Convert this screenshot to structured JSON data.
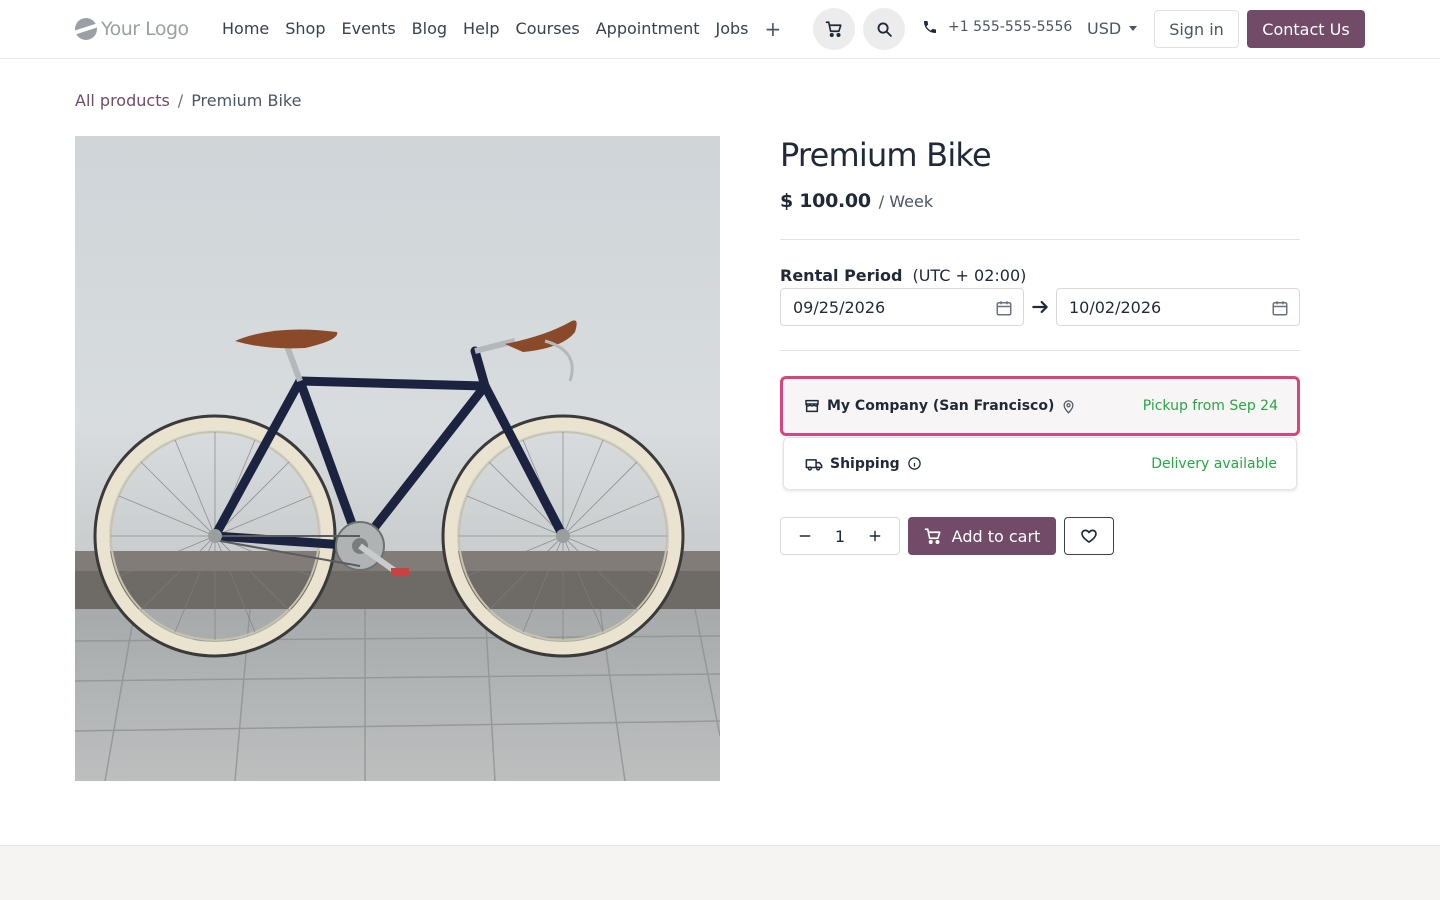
{
  "header": {
    "logo_text": "Your Logo",
    "nav": [
      "Home",
      "Shop",
      "Events",
      "Blog",
      "Help",
      "Courses",
      "Appointment",
      "Jobs"
    ],
    "nav_more": "+",
    "phone": "+1 555-555-5556",
    "currency": "USD",
    "sign_in": "Sign in",
    "contact": "Contact Us"
  },
  "breadcrumb": {
    "parent": "All products",
    "separator": "/",
    "current": "Premium Bike"
  },
  "product": {
    "title": "Premium Bike",
    "price": "$ 100.00",
    "period": "/ Week",
    "rental": {
      "label": "Rental Period",
      "timezone": "(UTC + 02:00)",
      "start": "09/25/2026",
      "end": "10/02/2026"
    },
    "pickup": {
      "name": "My Company (San Francisco)",
      "status": "Pickup from Sep 24"
    },
    "shipping": {
      "name": "Shipping",
      "status": "Delivery available"
    },
    "quantity": "1",
    "add_to_cart": "Add to cart"
  },
  "colors": {
    "brand": "#714b67",
    "selected_border": "#d9457a",
    "available": "#28a745"
  },
  "icons": [
    "cart-icon",
    "search-icon",
    "phone-icon",
    "calendar-icon",
    "arrow-right-icon",
    "store-icon",
    "map-pin-icon",
    "truck-icon",
    "info-icon",
    "minus-icon",
    "plus-icon",
    "heart-icon"
  ]
}
